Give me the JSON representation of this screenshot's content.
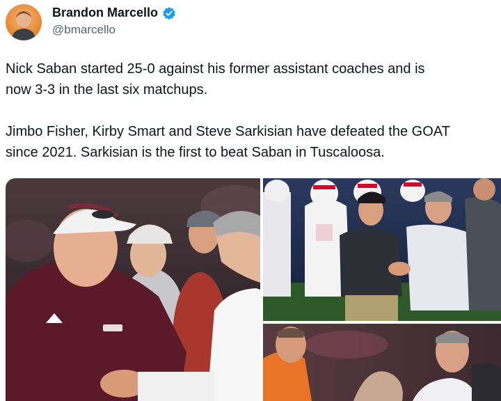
{
  "author": {
    "display_name": "Brandon Marcello",
    "handle": "@bmarcello",
    "verified": true,
    "avatar_icon": "profile-photo",
    "badge_color": "#1d9bf0"
  },
  "tweet": {
    "paragraphs": [
      "Nick Saban started 25-0 against his former assistant coaches and is now 3-3 in the last six matchups.",
      "Jimbo Fisher, Kirby Smart and Steve Sarkisian have defeated the GOAT since 2021. Sarkisian is the first to beat Saban in Tuscaloosa."
    ],
    "lines": [
      "Nick Saban started 25-0 against his former assistant coaches and is",
      "now 3-3 in the last six matchups.",
      "Jimbo Fisher, Kirby Smart and Steve Sarkisian have defeated the GOAT",
      "since 2021. Sarkisian is the first to beat Saban in Tuscaloosa."
    ]
  },
  "media": {
    "photos": [
      {
        "subject": "coaches-handshake-maroon",
        "colors": {
          "shirt": "#5a1a2a",
          "cap": "#f2f2f2",
          "background": "#3a2a2e"
        }
      },
      {
        "subject": "coaches-handshake-sideline",
        "colors": {
          "jersey": "#f4f4f4",
          "accent": "#c8102e",
          "background": "#1c2a4a"
        }
      },
      {
        "subject": "coaches-handshake-orange",
        "colors": {
          "jacket": "#e8742a",
          "background": "#4a2a30"
        }
      }
    ]
  }
}
